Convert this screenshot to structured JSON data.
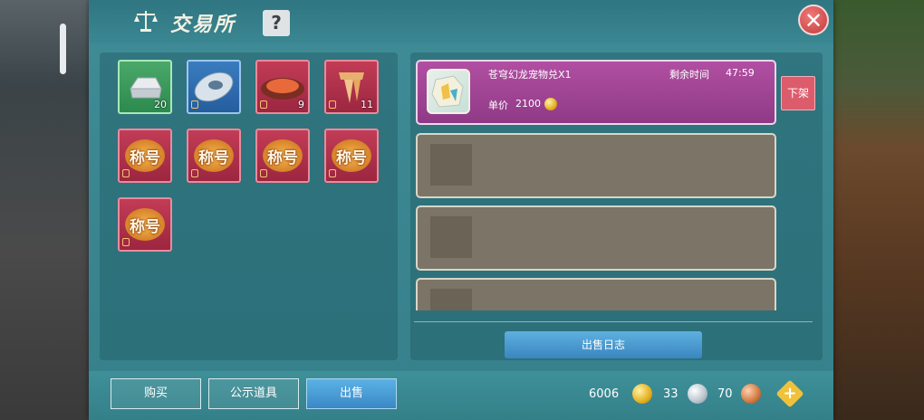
{
  "window": {
    "title": "交易所",
    "help_label": "?",
    "close_label": "✕"
  },
  "inventory": {
    "items": [
      {
        "kind": "silver-ingot",
        "rarity": "green",
        "count": "20"
      },
      {
        "kind": "stone",
        "rarity": "blue",
        "count": ""
      },
      {
        "kind": "meat",
        "rarity": "red",
        "count": "9"
      },
      {
        "kind": "scroll",
        "rarity": "red",
        "count": "11"
      },
      {
        "kind": "title",
        "rarity": "red",
        "label": "称号"
      },
      {
        "kind": "title",
        "rarity": "red",
        "label": "称号"
      },
      {
        "kind": "title",
        "rarity": "red",
        "label": "称号"
      },
      {
        "kind": "title",
        "rarity": "red",
        "label": "称号"
      },
      {
        "kind": "title",
        "rarity": "red",
        "label": "称号"
      }
    ]
  },
  "listing": {
    "item_name": "苍穹幻龙宠物兑X1",
    "time_label": "剩余时间",
    "time_value": "47:59",
    "price_label": "单价",
    "price_value": "2100",
    "delist_label": "下架",
    "sale_log_label": "出售日志"
  },
  "tabs": {
    "buy": "购买",
    "public": "公示道具",
    "sell": "出售"
  },
  "currency": {
    "gold": "6006",
    "silver": "33",
    "bronze": "70"
  }
}
